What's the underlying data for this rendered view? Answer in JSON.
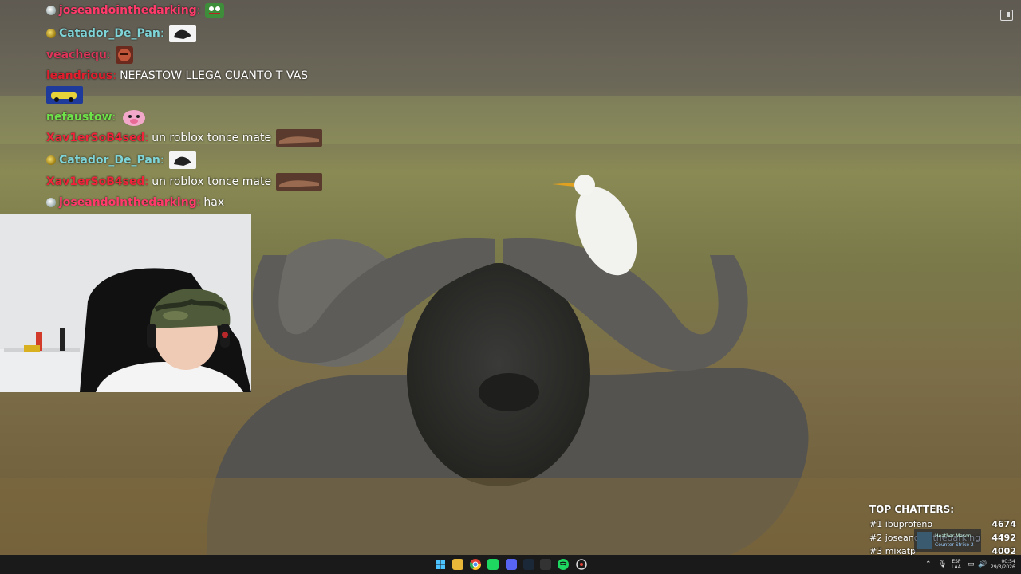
{
  "chat": [
    {
      "user": "joseandointhedarking",
      "user_color": "#ff3b6b",
      "badge": "gray",
      "text": "",
      "emote": "frog-emote"
    },
    {
      "user": "Catador_De_Pan",
      "user_color": "#7fd4d8",
      "badge": "gold",
      "text": "",
      "emote": "bird-emote"
    },
    {
      "user": "veachequ",
      "user_color": "#e0355a",
      "badge": "",
      "text": "",
      "emote": "face-emote"
    },
    {
      "user": "leandrious",
      "user_color": "#e01e2e",
      "badge": "",
      "text": "NEFASTOW LLEGA CUANTO T VAS",
      "emote": ""
    },
    {
      "user": "nefaustow",
      "user_color": "#6fe34a",
      "badge": "",
      "text": "",
      "emote": "pink-emote"
    },
    {
      "user": "Xav1erSoB4sed",
      "user_color": "#f0233a",
      "badge": "",
      "text": "un roblox tonce mate",
      "emote": "horse-emote"
    },
    {
      "user": "Catador_De_Pan",
      "user_color": "#7fd4d8",
      "badge": "gold",
      "text": "",
      "emote": "bird-emote"
    },
    {
      "user": "Xav1erSoB4sed",
      "user_color": "#f0233a",
      "badge": "",
      "text": "un roblox tonce mate",
      "emote": "horse-emote"
    },
    {
      "user": "joseandointhedarking",
      "user_color": "#ff3b6b",
      "badge": "gray",
      "text": "hax",
      "emote": ""
    }
  ],
  "top_chatters": {
    "title": "TOP CHATTERS:",
    "rows": [
      {
        "rank": "#1 ibuprofeno",
        "count": "4674"
      },
      {
        "rank": "#2 joseandointhedarking",
        "count": "4492"
      },
      {
        "rank": "#3 mixatp",
        "count": "4002"
      }
    ]
  },
  "mini_card": {
    "title": "Heather Mason",
    "subtitle": "Counter-Strike 2"
  },
  "taskbar": {
    "language_top": "ESP",
    "language_bottom": "LAA",
    "time": "00:54",
    "date": "29/3/2026"
  }
}
